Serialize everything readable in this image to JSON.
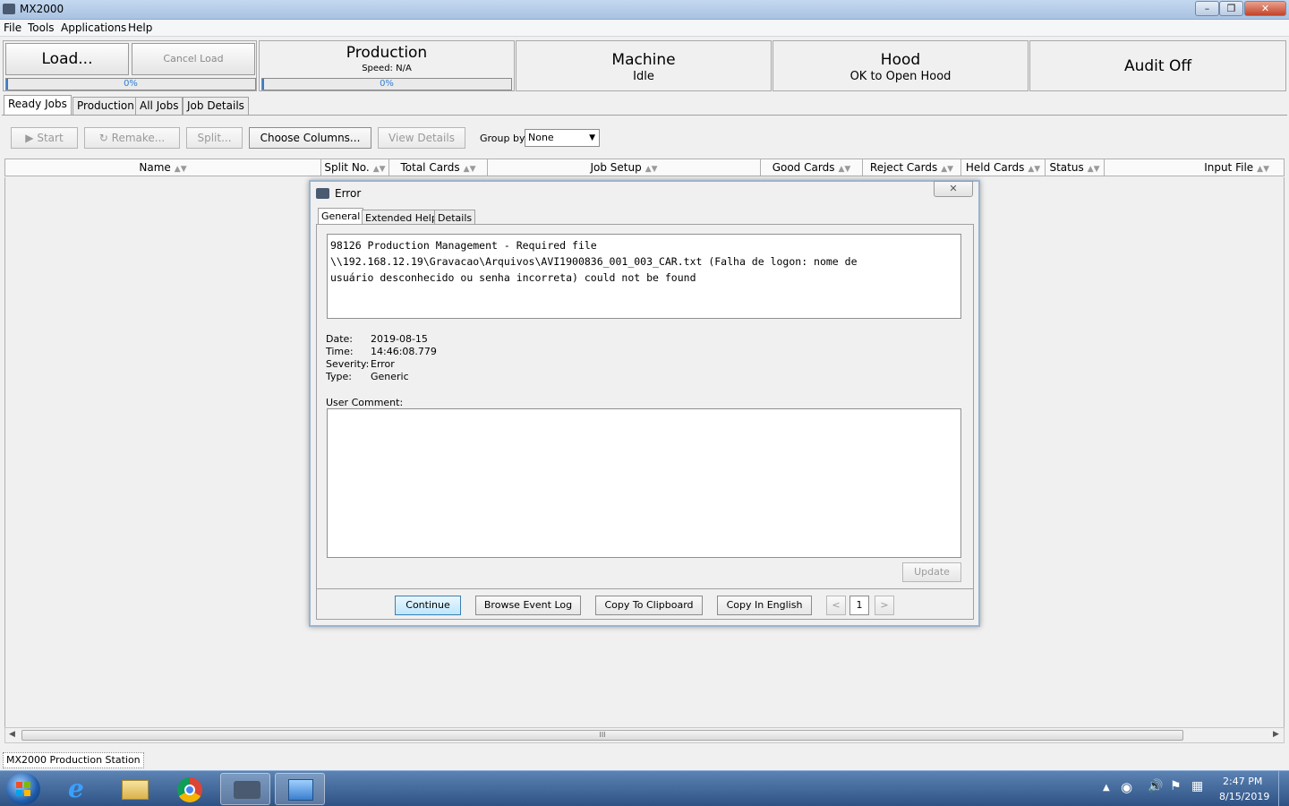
{
  "window": {
    "title": "MX2000",
    "minimize": "–",
    "maximize": "❐",
    "close": "✕"
  },
  "menu": [
    "File",
    "Tools",
    "Applications",
    "Help"
  ],
  "header": {
    "load_label": "Load...",
    "cancel_load_label": "Cancel Load",
    "load_progress": "0%",
    "production": {
      "title": "Production",
      "speed": "Speed: N/A",
      "progress": "0%"
    },
    "machine": {
      "title": "Machine",
      "status": "Idle"
    },
    "hood": {
      "title": "Hood",
      "status": "OK to Open Hood"
    },
    "audit": {
      "title": "Audit Off"
    }
  },
  "tabs": [
    "Ready Jobs",
    "Production",
    "All Jobs",
    "Job Details"
  ],
  "toolbar": {
    "start": "Start",
    "remake": "Remake...",
    "split": "Split...",
    "choose_columns": "Choose Columns...",
    "view_details": "View Details",
    "group_by_label": "Group by",
    "group_by_value": "None"
  },
  "table": {
    "columns": [
      "Name",
      "Split No.",
      "Total Cards",
      "Job Setup",
      "Good Cards",
      "Reject Cards",
      "Held Cards",
      "Status",
      "Input File"
    ],
    "scroll_grip": "III"
  },
  "status_bar": "MX2000 Production Station",
  "dialog": {
    "title": "Error",
    "close": "✕",
    "tabs": [
      "General",
      "Extended Help",
      "Details"
    ],
    "message": "98126 Production Management - Required file\n\\\\192.168.12.19\\Gravacao\\Arquivos\\AVI1900836_001_003_CAR.txt (Falha de logon: nome de\nusuário desconhecido ou senha incorreta) could not be found",
    "date_label": "Date:",
    "date": "2019-08-15",
    "time_label": "Time:",
    "time": "14:46:08.779",
    "severity_label": "Severity:",
    "severity": "Error",
    "type_label": "Type:",
    "type": "Generic",
    "user_comment_label": "User Comment:",
    "update": "Update",
    "continue": "Continue",
    "browse_event_log": "Browse Event Log",
    "copy_to_clipboard": "Copy To Clipboard",
    "copy_in_english": "Copy In English",
    "prev": "<",
    "page": "1",
    "next": ">"
  },
  "tray": {
    "time": "2:47 PM",
    "date": "8/15/2019"
  },
  "colors": {
    "accent": "#2f7fd8",
    "taskbar": "#2f5285"
  }
}
